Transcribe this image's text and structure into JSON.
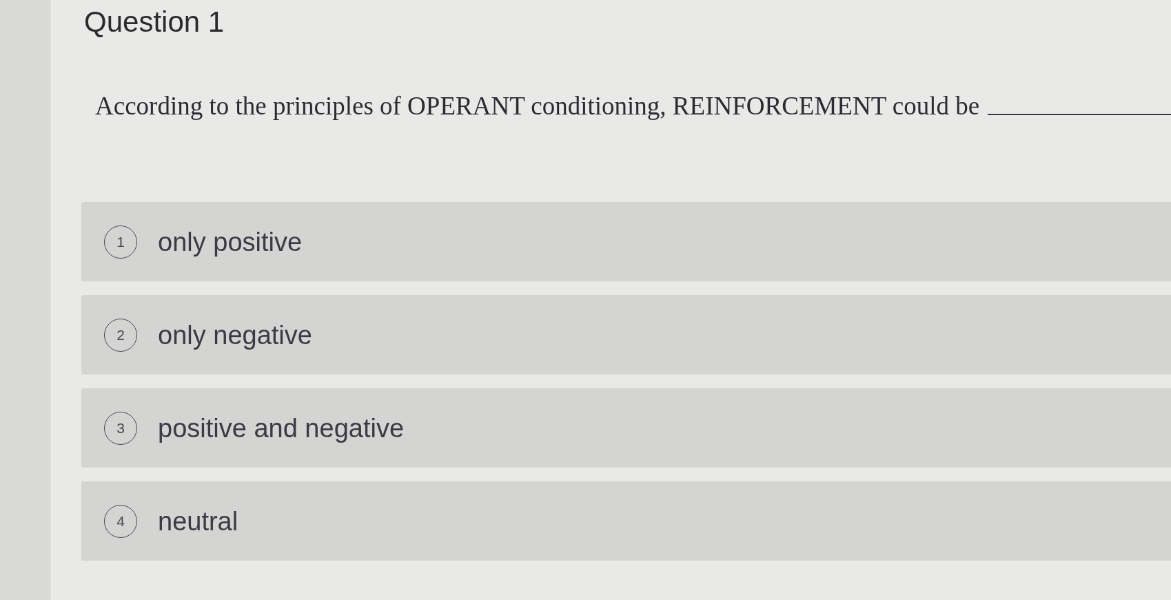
{
  "question": {
    "title": "Question 1",
    "text": "According to the principles of OPERANT conditioning, REINFORCEMENT could be"
  },
  "options": [
    {
      "number": "1",
      "label": "only positive",
      "selected": false
    },
    {
      "number": "2",
      "label": "only negative",
      "selected": false
    },
    {
      "number": "3",
      "label": "positive and negative",
      "selected": false
    },
    {
      "number": "4",
      "label": "neutral",
      "selected": false
    }
  ]
}
